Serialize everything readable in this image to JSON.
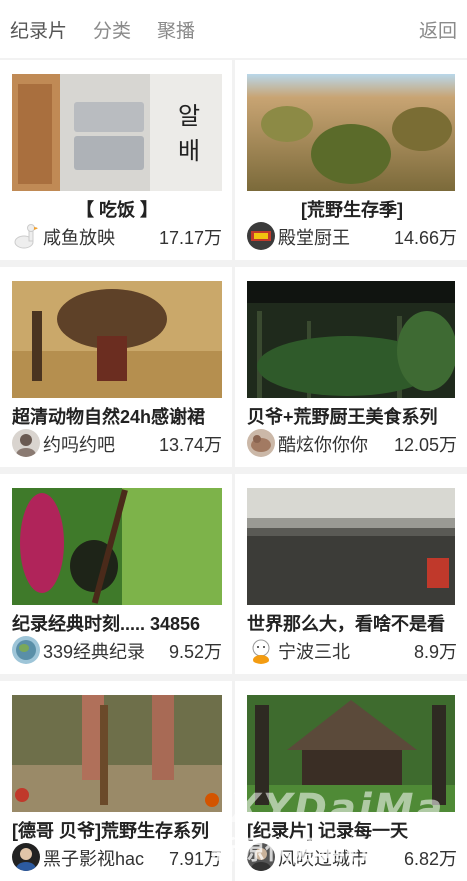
{
  "topbar": {
    "tabs": [
      "纪录片",
      "分类",
      "聚播"
    ],
    "back_label": "返回"
  },
  "cards": [
    {
      "title": "【 吃饭 】",
      "user": "咸鱼放映",
      "views": "17.17万",
      "avatar_icon": "goose-icon",
      "thumb_text": "알배"
    },
    {
      "title": "[荒野生存季]",
      "user": "殿堂厨王",
      "views": "14.66万",
      "avatar_icon": "food-avatar-icon"
    },
    {
      "title": "超清动物自然24h感谢裙",
      "user": "约吗约吧",
      "views": "13.74万",
      "avatar_icon": "person-avatar-icon"
    },
    {
      "title": "贝爷+荒野厨王美食系列",
      "user": "酷炫你你你",
      "views": "12.05万",
      "avatar_icon": "person-avatar-icon"
    },
    {
      "title": "纪录经典时刻..... 34856",
      "user": "339经典纪录",
      "views": "9.52万",
      "avatar_icon": "globe-avatar-icon"
    },
    {
      "title": "世界那么大，看啥不是看",
      "user": "宁波三北",
      "views": "8.9万",
      "avatar_icon": "cartoon-avatar-icon"
    },
    {
      "title": "[德哥 贝爷]荒野生存系列",
      "user": "黑子影视hac",
      "views": "7.91万",
      "avatar_icon": "person-avatar-icon"
    },
    {
      "title": "[纪录片] 记录每一天",
      "user": "风吹过城市",
      "views": "6.82万",
      "avatar_icon": "person-avatar-icon"
    }
  ],
  "watermark": {
    "en": "XYDaiMa",
    "cn": "新源代源码社区"
  }
}
